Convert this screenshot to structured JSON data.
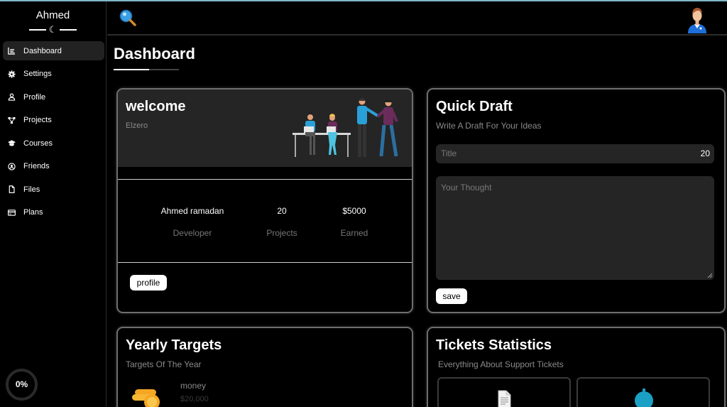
{
  "sidebar": {
    "brand": "Ahmed",
    "items": [
      {
        "label": "Dashboard",
        "icon": "chart-area-icon",
        "active": true
      },
      {
        "label": "Settings",
        "icon": "gear-icon",
        "active": false
      },
      {
        "label": "Profile",
        "icon": "user-icon",
        "active": false
      },
      {
        "label": "Projects",
        "icon": "diagram-icon",
        "active": false
      },
      {
        "label": "Courses",
        "icon": "graduation-cap-icon",
        "active": false
      },
      {
        "label": "Friends",
        "icon": "user-circle-icon",
        "active": false
      },
      {
        "label": "Files",
        "icon": "file-icon",
        "active": false
      },
      {
        "label": "Plans",
        "icon": "credit-card-icon",
        "active": false
      }
    ],
    "progress": {
      "label": "0%",
      "value": 0
    }
  },
  "header": {
    "search_icon": "search-icon",
    "avatar_icon": "avatar-icon"
  },
  "page": {
    "title": "Dashboard"
  },
  "welcome": {
    "title": "welcome",
    "subtitle": "Elzero",
    "stats": [
      {
        "value": "Ahmed ramadan",
        "label": "Developer"
      },
      {
        "value": "20",
        "label": "Projects"
      },
      {
        "value": "$5000",
        "label": "Earned"
      }
    ],
    "button": "profile"
  },
  "draft": {
    "title": "Quick Draft",
    "subtitle": "Write A Draft For Your Ideas",
    "title_placeholder": "Title",
    "title_count": "20",
    "thought_placeholder": "Your Thought",
    "button": "save"
  },
  "targets": {
    "title": "Yearly Targets",
    "subtitle": "Targets Of The Year",
    "item_name": "money",
    "item_value": "$20,000"
  },
  "tickets": {
    "title": "Tickets Statistics",
    "subtitle": "Everything About Support Tickets"
  },
  "colors": {
    "accent": "#0075ff",
    "coin": "#f5a623",
    "ticket_blue": "#1aa0c4"
  }
}
